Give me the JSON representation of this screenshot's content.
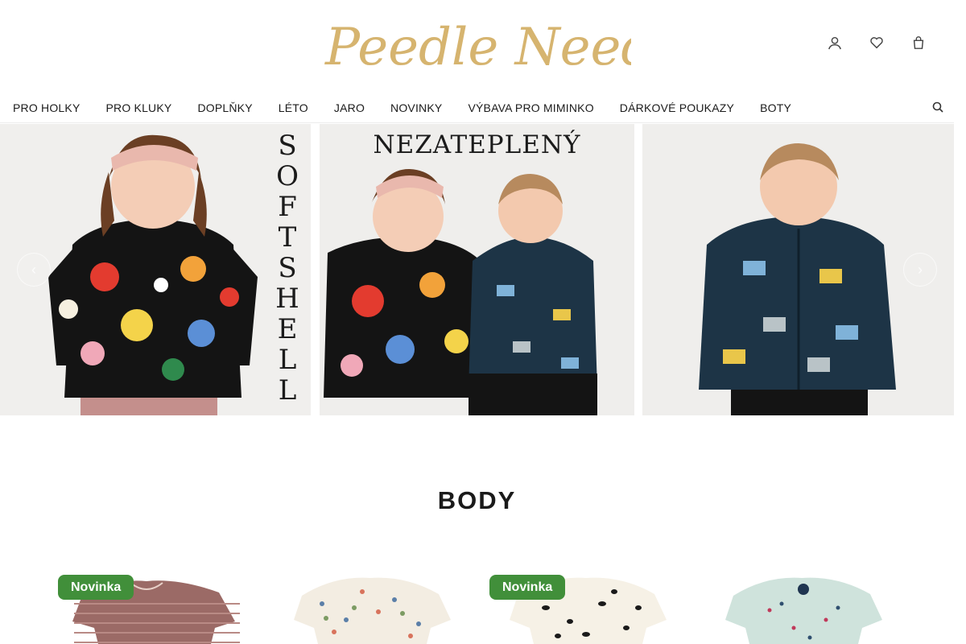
{
  "brand": {
    "logo_text": "Peedle Needle",
    "logo_color": "#d6b46f"
  },
  "header": {
    "icons": [
      {
        "name": "user-icon",
        "glyph": ""
      },
      {
        "name": "heart-icon",
        "glyph": ""
      },
      {
        "name": "cart-icon",
        "glyph": ""
      }
    ]
  },
  "nav": {
    "items": [
      "PRO HOLKY",
      "PRO KLUKY",
      "DOPLŇKY",
      "LÉTO",
      "JARO",
      "NOVINKY",
      "VÝBAVA PRO MIMINKO",
      "DÁRKOVÉ POUKAZY",
      "BOTY"
    ]
  },
  "carousel": {
    "panel1_vertical_text": "SOFTSHELL",
    "panel2_text": "NEZATEPLENÝ",
    "prev_label": "‹",
    "next_label": "›"
  },
  "section": {
    "title": "BODY"
  },
  "products": [
    {
      "badge": "Novinka",
      "color": "#9b6a66"
    },
    {
      "badge": "",
      "color": "#f3ede2"
    },
    {
      "badge": "Novinka",
      "color": "#f6f1e6"
    },
    {
      "badge": "",
      "color": "#cfe3dc"
    }
  ],
  "colors": {
    "badge_bg": "#418f3a",
    "accent": "#d6b46f"
  }
}
